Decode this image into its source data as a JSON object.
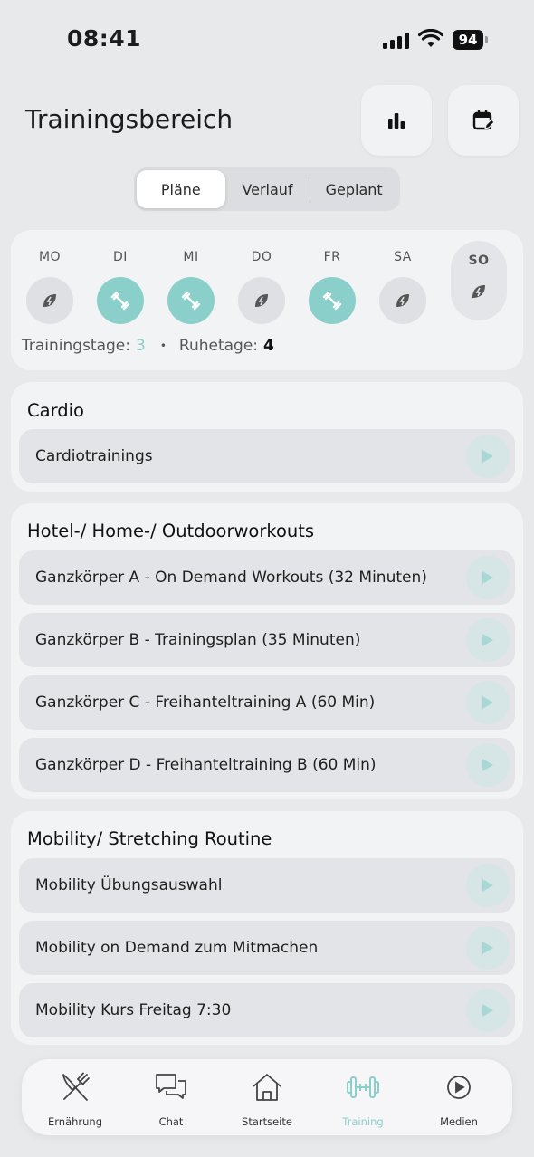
{
  "status_bar": {
    "time": "08:41",
    "battery": "94"
  },
  "header": {
    "title": "Trainingsbereich",
    "stats_icon": "bar-chart-icon",
    "calendar_icon": "calendar-edit-icon"
  },
  "tabs": [
    {
      "label": "Pläne",
      "active": true
    },
    {
      "label": "Verlauf",
      "active": false
    },
    {
      "label": "Geplant",
      "active": false
    }
  ],
  "week": {
    "days": [
      {
        "label": "MO",
        "type": "rest"
      },
      {
        "label": "DI",
        "type": "training"
      },
      {
        "label": "MI",
        "type": "training"
      },
      {
        "label": "DO",
        "type": "rest"
      },
      {
        "label": "FR",
        "type": "training"
      },
      {
        "label": "SA",
        "type": "rest"
      },
      {
        "label": "SO",
        "type": "rest",
        "today": true
      }
    ],
    "training_days_label": "Trainingstage:",
    "training_days_count": "3",
    "separator": "•",
    "rest_days_label": "Ruhetage:",
    "rest_days_count": "4"
  },
  "sections": [
    {
      "title": "Cardio",
      "items": [
        "Cardiotrainings"
      ]
    },
    {
      "title": "Hotel-/ Home-/ Outdoorworkouts",
      "items": [
        "Ganzkörper A - On Demand Workouts (32 Minuten)",
        "Ganzkörper B - Trainingsplan (35 Minuten)",
        "Ganzkörper C - Freihanteltraining A (60 Min)",
        "Ganzkörper D - Freihanteltraining B (60 Min)"
      ]
    },
    {
      "title": "Mobility/ Stretching Routine",
      "items": [
        "Mobility Übungsauswahl",
        "Mobility on Demand zum Mitmachen",
        "Mobility Kurs Freitag 7:30"
      ]
    }
  ],
  "nav": [
    {
      "label": "Ernährung",
      "icon": "fork-knife-icon",
      "active": false
    },
    {
      "label": "Chat",
      "icon": "chat-bubbles-icon",
      "active": false
    },
    {
      "label": "Startseite",
      "icon": "home-icon",
      "active": false
    },
    {
      "label": "Training",
      "icon": "dumbbell-icon",
      "active": true
    },
    {
      "label": "Medien",
      "icon": "play-circle-icon",
      "active": false
    }
  ],
  "colors": {
    "accent": "#8bcfca",
    "background": "#e8e9eb",
    "card": "#f2f3f5",
    "row": "#e3e4e7"
  }
}
